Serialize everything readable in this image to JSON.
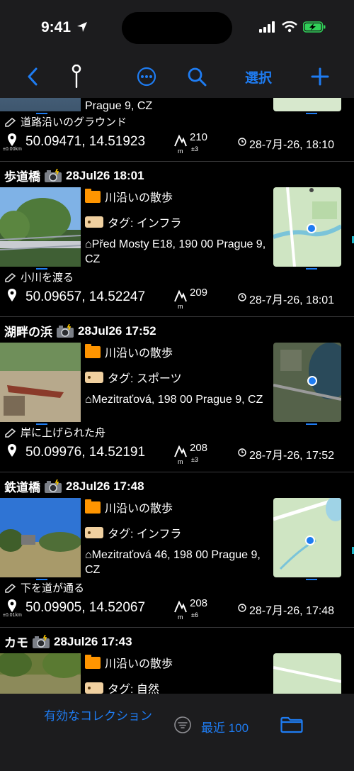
{
  "status": {
    "time": "9:41"
  },
  "nav": {
    "select_label": "選択"
  },
  "entries": [
    {
      "address_tail": "Prague 9, CZ",
      "note": "道路沿いのグラウンド",
      "coords": "50.09471, 14.51923",
      "accuracy": "±0.00km",
      "altitude": "210",
      "altitude_unit": "m",
      "altitude_acc": "±3",
      "datetime": "28-7月-26, 18:10"
    },
    {
      "title": "歩道橋",
      "date": "28Jul26 18:01",
      "folder": "川沿いの散歩",
      "tag": "タグ: インフラ",
      "address": "⌂Před Mosty E18, 190 00 Prague 9, CZ",
      "note": "小川を渡る",
      "coords": "50.09657, 14.52247",
      "accuracy": "",
      "altitude": "209",
      "altitude_unit": "m",
      "altitude_acc": "",
      "datetime": "28-7月-26, 18:01"
    },
    {
      "title": "湖畔の浜",
      "date": "28Jul26 17:52",
      "folder": "川沿いの散歩",
      "tag": "タグ: スポーツ",
      "address": "⌂Mezitraťová, 198 00 Prague 9, CZ",
      "note": "岸に上げられた舟",
      "coords": "50.09976, 14.52191",
      "accuracy": "",
      "altitude": "208",
      "altitude_unit": "m",
      "altitude_acc": "±3",
      "datetime": "28-7月-26, 17:52"
    },
    {
      "title": "鉄道橋",
      "date": "28Jul26 17:48",
      "folder": "川沿いの散歩",
      "tag": "タグ: インフラ",
      "address": "⌂Mezitraťová 46, 198 00 Prague 9, CZ",
      "note": "下を道が通る",
      "coords": "50.09905, 14.52067",
      "accuracy": "±0.01km",
      "altitude": "208",
      "altitude_unit": "m",
      "altitude_acc": "±6",
      "datetime": "28-7月-26, 17:48"
    },
    {
      "title": "カモ",
      "date": "28Jul26 17:43",
      "folder": "川沿いの散歩",
      "tag": "タグ: 自然"
    }
  ],
  "tabbar": {
    "collection_label": "有効なコレクション",
    "recent_label": "最近 100"
  },
  "colors": {
    "accent": "#1e7cf2",
    "folder": "#ff9500",
    "background": "#000000",
    "bar": "#1c1c1e"
  }
}
